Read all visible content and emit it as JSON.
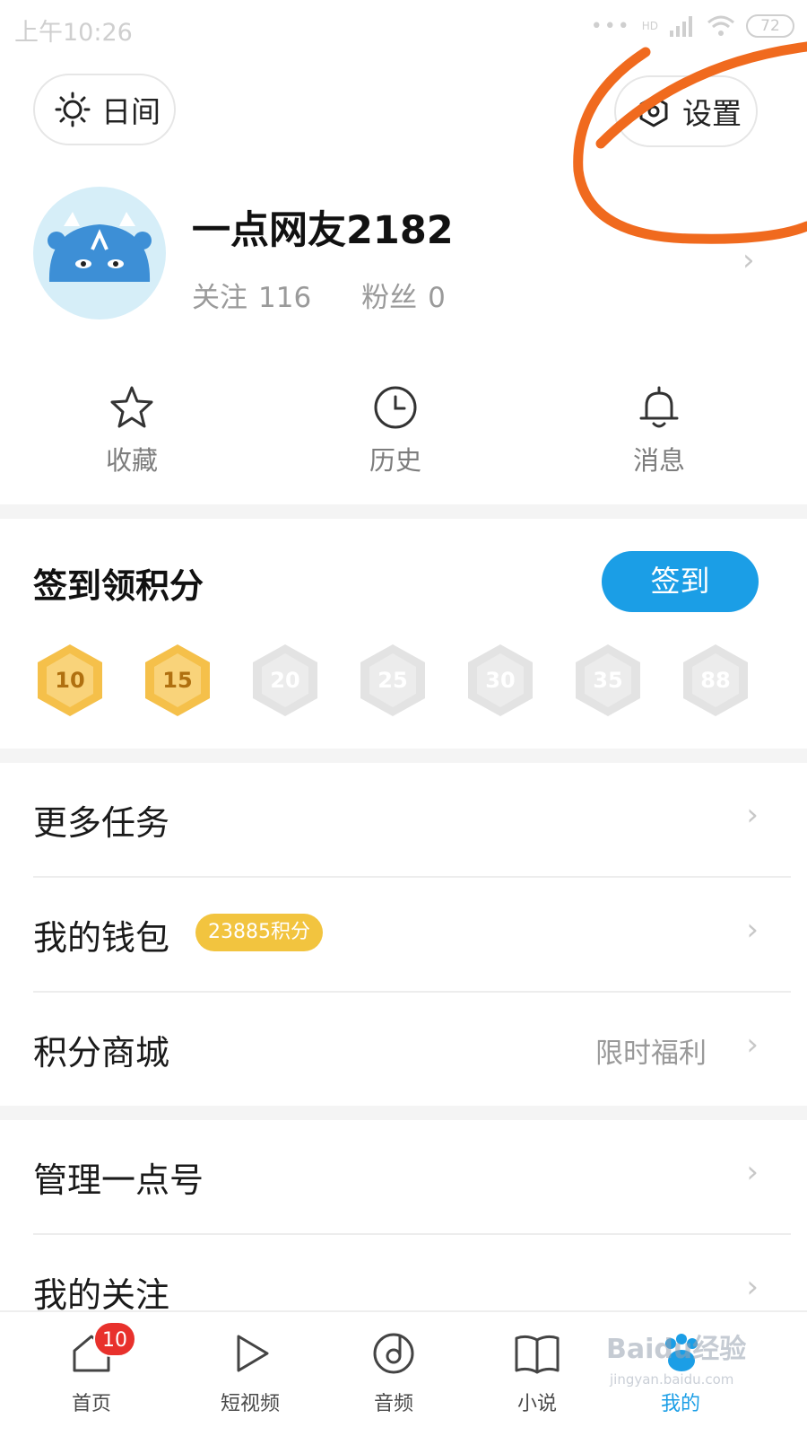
{
  "status_bar": {
    "time": "上午10:26",
    "network": "HD",
    "battery": "72"
  },
  "header": {
    "day_mode_label": "日间",
    "settings_label": "设置"
  },
  "profile": {
    "username": "一点网友2182",
    "following_label": "关注",
    "following_count": "116",
    "fans_label": "粉丝",
    "fans_count": "0"
  },
  "quick_actions": [
    {
      "label": "收藏",
      "icon": "star-icon"
    },
    {
      "label": "历史",
      "icon": "clock-icon"
    },
    {
      "label": "消息",
      "icon": "bell-icon"
    }
  ],
  "checkin": {
    "title": "签到领积分",
    "button_label": "签到",
    "coins": [
      {
        "value": "10",
        "claimed": true
      },
      {
        "value": "15",
        "claimed": true
      },
      {
        "value": "20",
        "claimed": false
      },
      {
        "value": "25",
        "claimed": false
      },
      {
        "value": "30",
        "claimed": false
      },
      {
        "value": "35",
        "claimed": false
      },
      {
        "value": "88",
        "claimed": false
      }
    ]
  },
  "menu": {
    "more_tasks": "更多任务",
    "wallet": "我的钱包",
    "wallet_badge": "23885积分",
    "points_mall": "积分商城",
    "points_mall_note": "限时福利",
    "manage_account": "管理一点号",
    "my_follows": "我的关注"
  },
  "tabbar": {
    "tabs": [
      {
        "label": "首页",
        "icon": "home-icon",
        "badge": "10"
      },
      {
        "label": "短视频",
        "icon": "play-icon"
      },
      {
        "label": "音频",
        "icon": "audio-disc-icon"
      },
      {
        "label": "小说",
        "icon": "book-icon"
      },
      {
        "label": "我的",
        "icon": "paw-icon",
        "active": true
      }
    ]
  },
  "watermark": {
    "text": "Baidu经验",
    "sub": "jingyan.baidu.com"
  },
  "colors": {
    "accent": "#1b9ee6",
    "coin_gold": "#f5c04a",
    "coin_grey": "#e3e3e3",
    "badge_yellow": "#f2c43f",
    "badge_red": "#e8312c",
    "annotation_orange": "#f06a1e"
  }
}
